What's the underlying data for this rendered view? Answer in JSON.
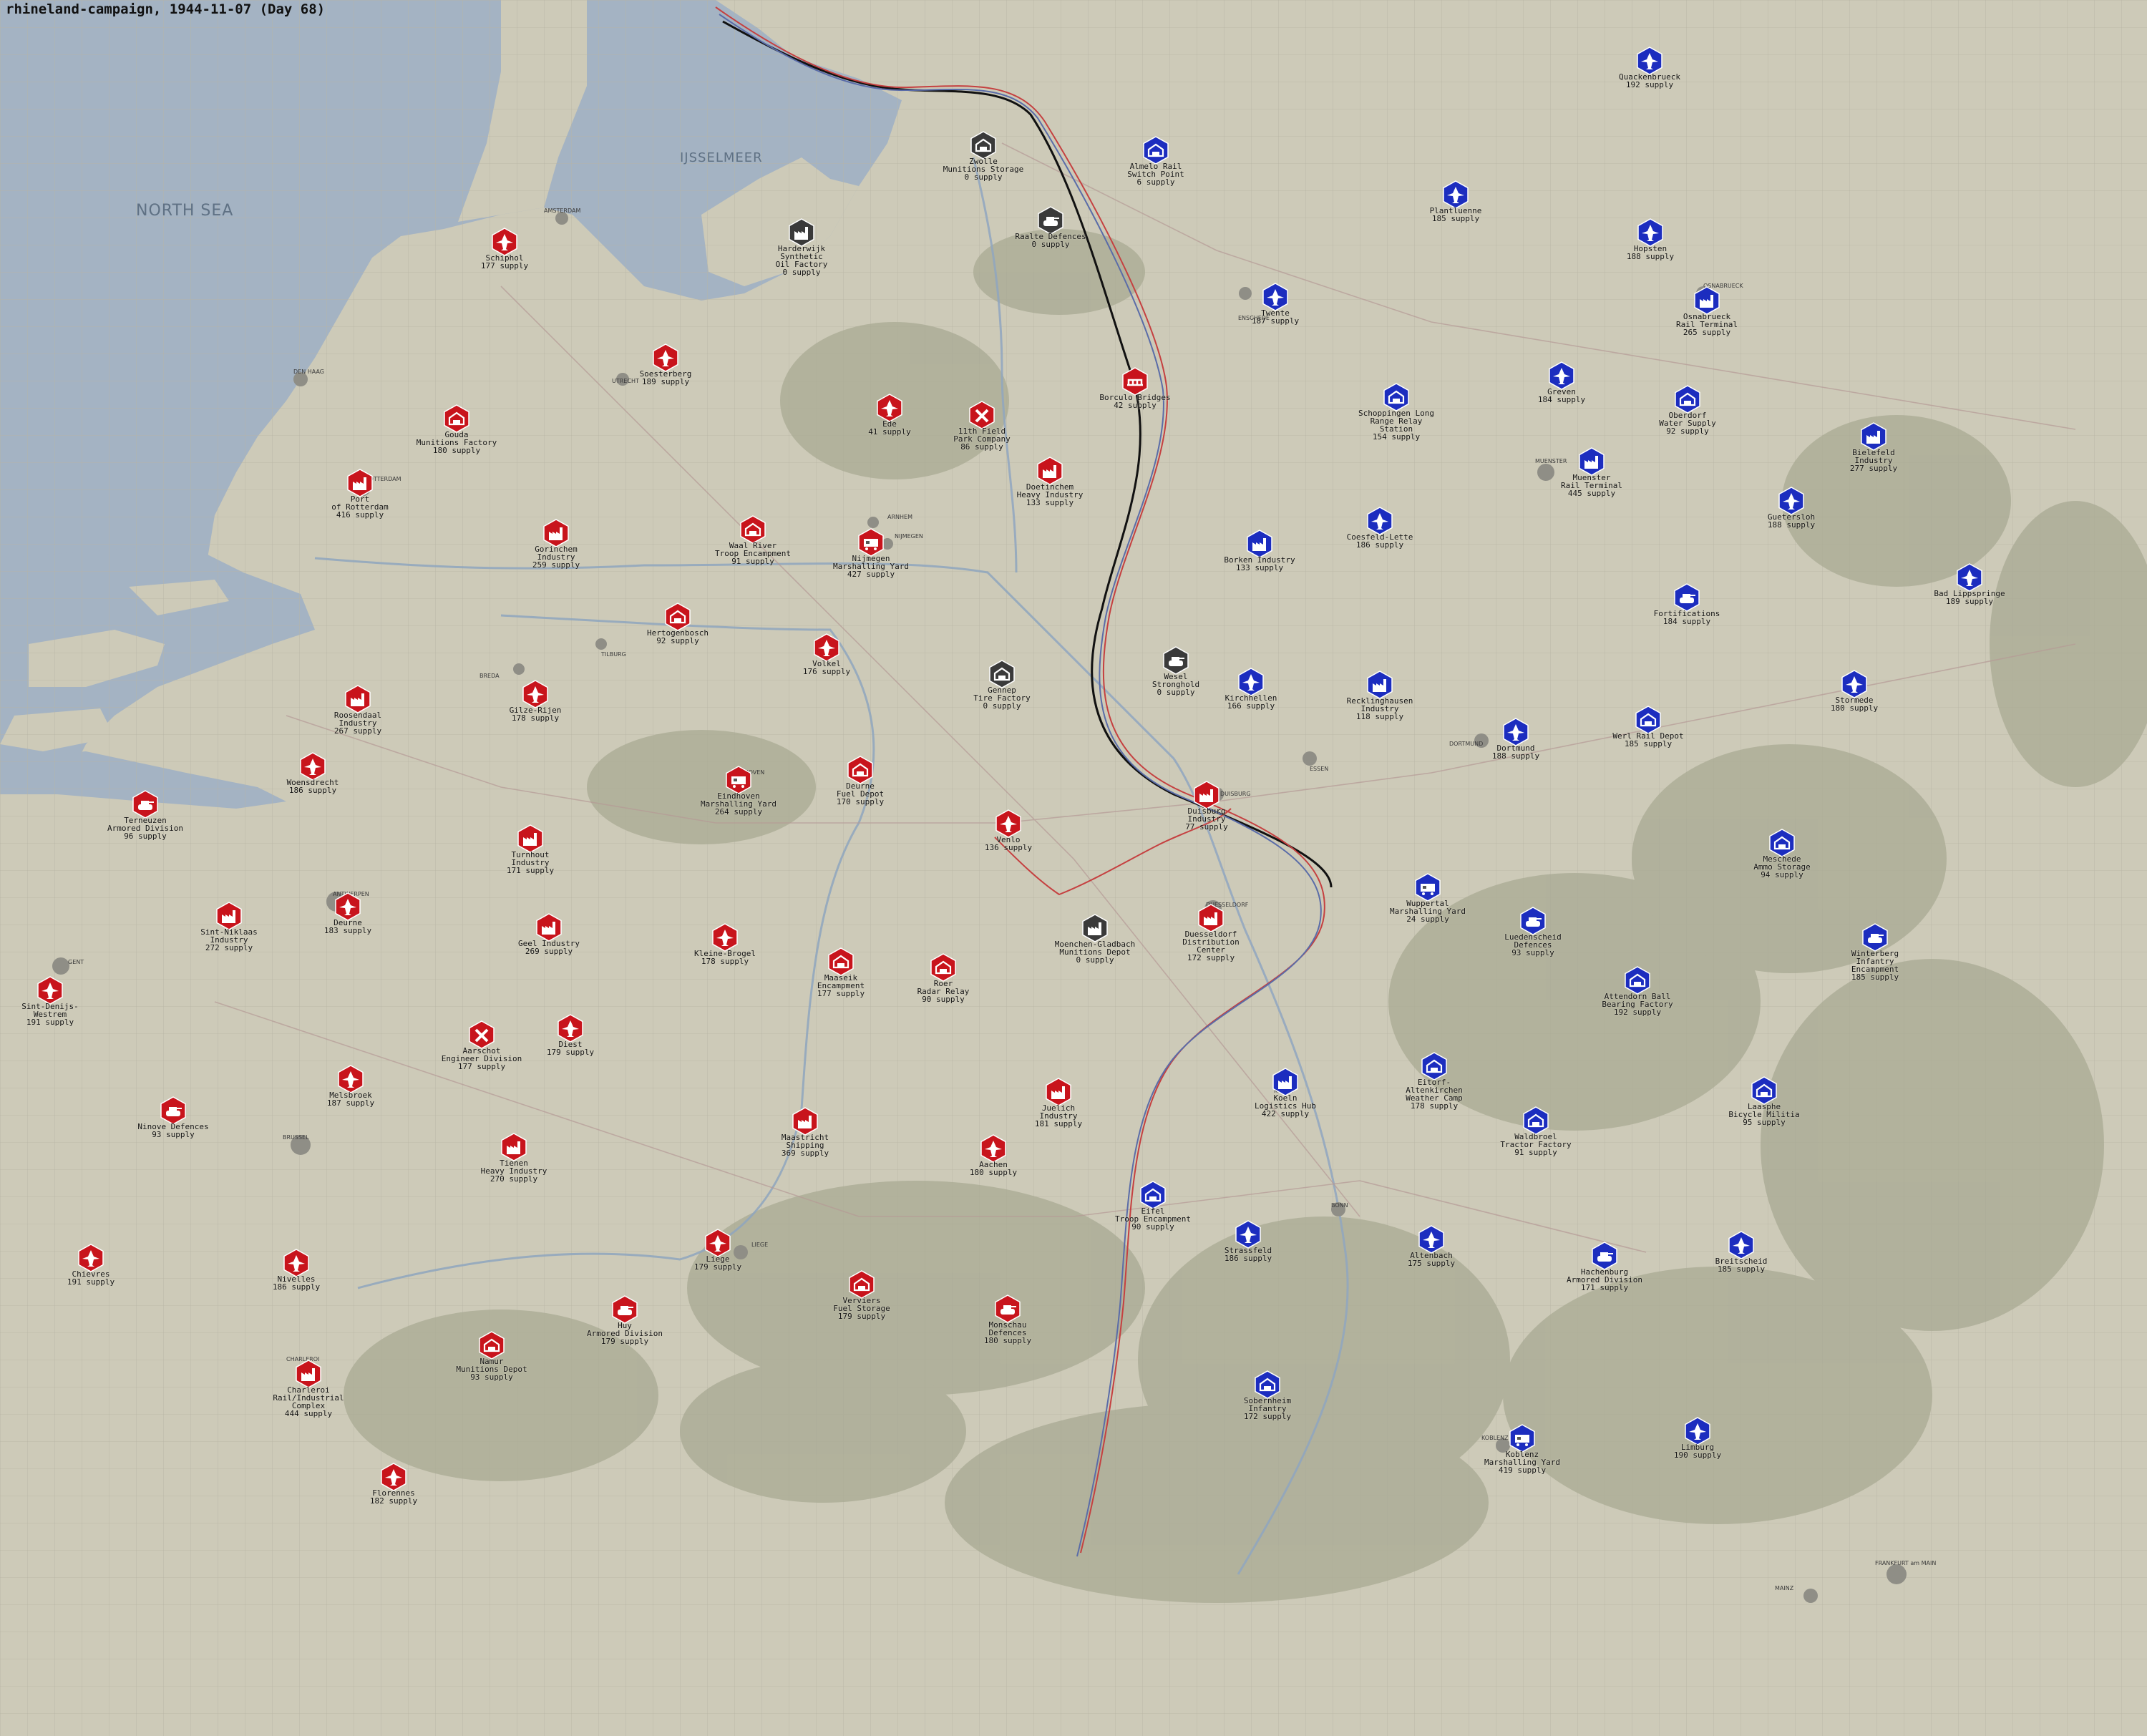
{
  "title": "rhineland-campaign, 1944-11-07 (Day 68)",
  "colors": {
    "sea": "#a4b3c3",
    "land": "#cdcab8",
    "allied": "#c8141c",
    "axis": "#1c2dbf",
    "neutral": "#3a3a3a",
    "frontline": "#111111"
  },
  "regions": {
    "sea": "NORTH SEA",
    "lake": "IJSSELMEER"
  },
  "cities": [
    "AMSTERDAM",
    "DEN HAAG",
    "ROTTERDAM",
    "UTRECHT",
    "ARNHEM",
    "NIJMEGEN",
    "EINDHOVEN",
    "ANTWERPEN",
    "BRUSSEL",
    "GENT",
    "LIEGE",
    "CHARLEROI",
    "DUISBURG",
    "ESSEN",
    "DORTMUND",
    "DUESSELDORF",
    "KOELN",
    "BONN",
    "KOBLENZ",
    "FRANKFURT am MAIN",
    "MAINZ",
    "MUENSTER",
    "OSNABRUECK",
    "ENSCHEDE",
    "TILBURG",
    "BREDA"
  ],
  "objectives": [
    {
      "name": "Zwolle",
      "label": "Zwolle\nMunitions Storage\n0 supply",
      "side": "neutral",
      "icon": "depot-icon"
    },
    {
      "name": "Almelo",
      "label": "Almelo Rail\nSwitch Point\n6 supply",
      "side": "axis",
      "icon": "depot-icon"
    },
    {
      "name": "Quakenbrueck",
      "label": "Quackenbrueck\n192 supply",
      "side": "axis",
      "icon": "airfield-icon"
    },
    {
      "name": "Plantluenne",
      "label": "Plantluenne\n185 supply",
      "side": "axis",
      "icon": "airfield-icon"
    },
    {
      "name": "Hopsten",
      "label": "Hopsten\n188 supply",
      "side": "axis",
      "icon": "airfield-icon"
    },
    {
      "name": "Raalte",
      "label": "Raalte Defences\n0 supply",
      "side": "neutral",
      "icon": "armor-icon"
    },
    {
      "name": "Harderwijk",
      "label": "Harderwijk Synthetic\nOil Factory\n0 supply",
      "side": "neutral",
      "icon": "factory-icon"
    },
    {
      "name": "Schiphol",
      "label": "Schiphol\n177 supply",
      "side": "allied",
      "icon": "airfield-icon"
    },
    {
      "name": "Twente",
      "label": "Twente\n187 supply",
      "side": "axis",
      "icon": "airfield-icon"
    },
    {
      "name": "Osnabrueck",
      "label": "Osnabrueck\nRail Terminal\n265 supply",
      "side": "axis",
      "icon": "factory-icon"
    },
    {
      "name": "Soesterberg",
      "label": "Soesterberg\n189 supply",
      "side": "allied",
      "icon": "airfield-icon"
    },
    {
      "name": "Borculo",
      "label": "Borculo Bridges\n42 supply",
      "side": "allied",
      "icon": "bridge-icon"
    },
    {
      "name": "Gouda",
      "label": "Gouda\nMunitions Factory\n180 supply",
      "side": "allied",
      "icon": "depot-icon"
    },
    {
      "name": "Ede",
      "label": "Ede\n41 supply",
      "side": "allied",
      "icon": "airfield-icon"
    },
    {
      "name": "11th Field",
      "label": "11th Field\nPark Company\n86 supply",
      "side": "allied",
      "icon": "engineer-icon"
    },
    {
      "name": "Greven",
      "label": "Greven\n184 supply",
      "side": "axis",
      "icon": "airfield-icon"
    },
    {
      "name": "Schoppingen",
      "label": "Schoppingen Long\nRange Relay Station\n154 supply",
      "side": "axis",
      "icon": "depot-icon"
    },
    {
      "name": "Oberdorf",
      "label": "Oberdorf\nWater Supply\n92 supply",
      "side": "axis",
      "icon": "depot-icon"
    },
    {
      "name": "Bielefeld",
      "label": "Bielefeld\nIndustry\n277 supply",
      "side": "axis",
      "icon": "factory-icon"
    },
    {
      "name": "Doetinchem",
      "label": "Doetinchem\nHeavy Industry\n133 supply",
      "side": "allied",
      "icon": "factory-icon"
    },
    {
      "name": "Rotterdam",
      "label": "Port\nof Rotterdam\n416 supply",
      "side": "allied",
      "icon": "factory-icon"
    },
    {
      "name": "Muenster",
      "label": "Muenster\nRail Terminal\n445 supply",
      "side": "axis",
      "icon": "factory-icon"
    },
    {
      "name": "Guetersloh",
      "label": "Guetersloh\n188 supply",
      "side": "axis",
      "icon": "airfield-icon"
    },
    {
      "name": "Gorinchem",
      "label": "Gorinchem\nIndustry\n259 supply",
      "side": "allied",
      "icon": "factory-icon"
    },
    {
      "name": "Waal River",
      "label": "Waal River\nTroop Encampment\n91 supply",
      "side": "allied",
      "icon": "depot-icon"
    },
    {
      "name": "Nijmegen",
      "label": "Nijmegen\nMarshalling Yard\n427 supply",
      "side": "allied",
      "icon": "rail-icon"
    },
    {
      "name": "Borken",
      "label": "Borken Industry\n133 supply",
      "side": "axis",
      "icon": "factory-icon"
    },
    {
      "name": "Coesfeld",
      "label": "Coesfeld-Lette\n186 supply",
      "side": "axis",
      "icon": "airfield-icon"
    },
    {
      "name": "Bad Lippspringe",
      "label": "Bad Lippspringe\n189 supply",
      "side": "axis",
      "icon": "airfield-icon"
    },
    {
      "name": "Fortifications",
      "label": "Fortifications\n184 supply",
      "side": "axis",
      "icon": "armor-icon"
    },
    {
      "name": "Hertogenbosch",
      "label": "Hertogenbosch\n92 supply",
      "side": "allied",
      "icon": "depot-icon"
    },
    {
      "name": "Volkel",
      "label": "Volkel\n176 supply",
      "side": "allied",
      "icon": "airfield-icon"
    },
    {
      "name": "Gennep",
      "label": "Gennep\nTire Factory\n0 supply",
      "side": "neutral",
      "icon": "depot-icon"
    },
    {
      "name": "Wesel",
      "label": "Wesel\nStronghold\n0 supply",
      "side": "neutral",
      "icon": "armor-icon"
    },
    {
      "name": "Kirchhellen",
      "label": "Kirchhellen\n166 supply",
      "side": "axis",
      "icon": "airfield-icon"
    },
    {
      "name": "Recklinghausen",
      "label": "Recklinghausen\nIndustry\n118 supply",
      "side": "axis",
      "icon": "factory-icon"
    },
    {
      "name": "Dortmund",
      "label": "Dortmund\n188 supply",
      "side": "axis",
      "icon": "airfield-icon"
    },
    {
      "name": "Werl",
      "label": "Werl Rail Depot\n185 supply",
      "side": "axis",
      "icon": "depot-icon"
    },
    {
      "name": "Stormede",
      "label": "Stormede\n180 supply",
      "side": "axis",
      "icon": "airfield-icon"
    },
    {
      "name": "Roosendaal",
      "label": "Roosendaal\nIndustry\n267 supply",
      "side": "allied",
      "icon": "factory-icon"
    },
    {
      "name": "Gilze-Rijen",
      "label": "Gilze-Rijen\n178 supply",
      "side": "allied",
      "icon": "airfield-icon"
    },
    {
      "name": "Woensdrecht",
      "label": "Woensdrecht\n186 supply",
      "side": "allied",
      "icon": "airfield-icon"
    },
    {
      "name": "Eindhoven",
      "label": "Eindhoven\nMarshalling Yard\n264 supply",
      "side": "allied",
      "icon": "rail-icon"
    },
    {
      "name": "Deurne",
      "label": "Deurne\nFuel Depot\n170 supply",
      "side": "allied",
      "icon": "depot-icon"
    },
    {
      "name": "Duisburg",
      "label": "Duisburg\nIndustry\n77 supply",
      "side": "allied",
      "icon": "factory-icon"
    },
    {
      "name": "Terneuzen",
      "label": "Terneuzen\nArmored Division\n96 supply",
      "side": "allied",
      "icon": "armor-icon"
    },
    {
      "name": "Turnhout",
      "label": "Turnhout\nIndustry\n171 supply",
      "side": "allied",
      "icon": "factory-icon"
    },
    {
      "name": "Venlo",
      "label": "Venlo\n136 supply",
      "side": "allied",
      "icon": "airfield-icon"
    },
    {
      "name": "Meschede",
      "label": "Meschede\nAmmo Storage\n94 supply",
      "side": "axis",
      "icon": "depot-icon"
    },
    {
      "name": "Sint-Niklaas",
      "label": "Sint-Niklaas\nIndustry\n272 supply",
      "side": "allied",
      "icon": "factory-icon"
    },
    {
      "name": "Deurne BE",
      "label": "Deurne\n183 supply",
      "side": "allied",
      "icon": "airfield-icon"
    },
    {
      "name": "Geel",
      "label": "Geel Industry\n269 supply",
      "side": "allied",
      "icon": "factory-icon"
    },
    {
      "name": "Wuppertal",
      "label": "Wuppertal\nMarshalling Yard\n24 supply",
      "side": "axis",
      "icon": "rail-icon"
    },
    {
      "name": "Luedenscheid",
      "label": "Luedenscheid\nDefences\n93 supply",
      "side": "axis",
      "icon": "armor-icon"
    },
    {
      "name": "Winterberg",
      "label": "Winterberg\nInfantry Encampment\n185 supply",
      "side": "axis",
      "icon": "armor-icon"
    },
    {
      "name": "Moenchengladbach",
      "label": "Moenchen-Gladbach\nMunitions Depot\n0 supply",
      "side": "neutral",
      "icon": "factory-icon"
    },
    {
      "name": "Duesseldorf",
      "label": "Duesseldorf\nDistribution Center\n172 supply",
      "side": "allied",
      "icon": "factory-icon"
    },
    {
      "name": "Kleine-Brogel",
      "label": "Kleine-Brogel\n178 supply",
      "side": "allied",
      "icon": "airfield-icon"
    },
    {
      "name": "Maaseik",
      "label": "Maaseik\nEncampment\n177 supply",
      "side": "allied",
      "icon": "depot-icon"
    },
    {
      "name": "Roer",
      "label": "Roer\nRadar Relay\n90 supply",
      "side": "allied",
      "icon": "depot-icon"
    },
    {
      "name": "Attendorn",
      "label": "Attendorn Ball\nBearing Factory\n192 supply",
      "side": "axis",
      "icon": "depot-icon"
    },
    {
      "name": "Sint-Denijs",
      "label": "Sint-Denijs-Westrem\n191 supply",
      "side": "allied",
      "icon": "airfield-icon"
    },
    {
      "name": "Aarschot",
      "label": "Aarschot\nEngineer Division\n177 supply",
      "side": "allied",
      "icon": "engineer-icon"
    },
    {
      "name": "Diest",
      "label": "Diest\n179 supply",
      "side": "allied",
      "icon": "airfield-icon"
    },
    {
      "name": "Melsbroek",
      "label": "Melsbroek\n187 supply",
      "side": "allied",
      "icon": "airfield-icon"
    },
    {
      "name": "Koeln",
      "label": "Koeln\nLogistics Hub\n422 supply",
      "side": "axis",
      "icon": "factory-icon"
    },
    {
      "name": "Eitorf",
      "label": "Eitorf-Altenkirchen\nWeather Camp\n178 supply",
      "side": "axis",
      "icon": "depot-icon"
    },
    {
      "name": "Laasphe",
      "label": "Laasphe\nBicycle Militia\n95 supply",
      "side": "axis",
      "icon": "depot-icon"
    },
    {
      "name": "Ninove",
      "label": "Ninove Defences\n93 supply",
      "side": "allied",
      "icon": "armor-icon"
    },
    {
      "name": "Tienen",
      "label": "Tienen\nHeavy Industry\n270 supply",
      "side": "allied",
      "icon": "factory-icon"
    },
    {
      "name": "Maastricht",
      "label": "Maastricht\nShipping\n369 supply",
      "side": "allied",
      "icon": "factory-icon"
    },
    {
      "name": "Juelich",
      "label": "Juelich\nIndustry\n181 supply",
      "side": "allied",
      "icon": "factory-icon"
    },
    {
      "name": "Waldbroel",
      "label": "Waldbroel\nTractor Factory\n91 supply",
      "side": "axis",
      "icon": "depot-icon"
    },
    {
      "name": "Aachen",
      "label": "Aachen\n180 supply",
      "side": "allied",
      "icon": "airfield-icon"
    },
    {
      "name": "Eifel",
      "label": "Eifel\nTroop Encampment\n90 supply",
      "side": "axis",
      "icon": "depot-icon"
    },
    {
      "name": "Chievres",
      "label": "Chievres\n191 supply",
      "side": "allied",
      "icon": "airfield-icon"
    },
    {
      "name": "Nivelles",
      "label": "Nivelles\n186 supply",
      "side": "allied",
      "icon": "airfield-icon"
    },
    {
      "name": "Liege",
      "label": "Liege\n179 supply",
      "side": "allied",
      "icon": "airfield-icon"
    },
    {
      "name": "Strassfeld",
      "label": "Strassfeld\n186 supply",
      "side": "axis",
      "icon": "airfield-icon"
    },
    {
      "name": "Altenbach",
      "label": "Altenbach\n175 supply",
      "side": "axis",
      "icon": "airfield-icon"
    },
    {
      "name": "Hachenburg",
      "label": "Hachenburg\nArmored Division\n171 supply",
      "side": "axis",
      "icon": "armor-icon"
    },
    {
      "name": "Breitscheid",
      "label": "Breitscheid\n185 supply",
      "side": "axis",
      "icon": "airfield-icon"
    },
    {
      "name": "Verviers",
      "label": "Verviers\nFuel Storage\n179 supply",
      "side": "allied",
      "icon": "depot-icon"
    },
    {
      "name": "Monschau",
      "label": "Monschau\nDefences\n180 supply",
      "side": "allied",
      "icon": "armor-icon"
    },
    {
      "name": "Huy",
      "label": "Huy\nArmored Division\n179 supply",
      "side": "allied",
      "icon": "armor-icon"
    },
    {
      "name": "Namur",
      "label": "Namur\nMunitions Depot\n93 supply",
      "side": "allied",
      "icon": "depot-icon"
    },
    {
      "name": "Charleroi",
      "label": "Charleroi\nRail/Industrial Complex\n444 supply",
      "side": "allied",
      "icon": "factory-icon"
    },
    {
      "name": "Sobernheim",
      "label": "Sobernheim\nInfantry\n172 supply",
      "side": "axis",
      "icon": "depot-icon"
    },
    {
      "name": "Koblenz",
      "label": "Koblenz\nMarshalling Yard\n419 supply",
      "side": "axis",
      "icon": "rail-icon"
    },
    {
      "name": "Limburg",
      "label": "Limburg\n190 supply",
      "side": "axis",
      "icon": "airfield-icon"
    },
    {
      "name": "Florennes",
      "label": "Florennes\n182 supply",
      "side": "allied",
      "icon": "airfield-icon"
    }
  ]
}
